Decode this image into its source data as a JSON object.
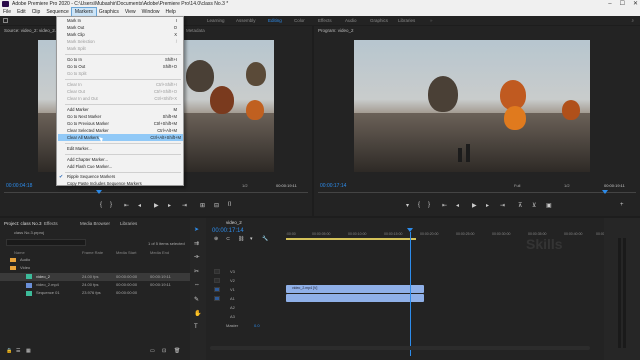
{
  "titlebar": {
    "title": "Adobe Premiere Pro 2020 - C:\\Users\\Mubashir\\Documents\\Adobe\\Premiere Pro\\14.0\\class No.3 *"
  },
  "menubar": {
    "items": [
      "File",
      "Edit",
      "Clip",
      "Sequence",
      "Markers",
      "Graphics",
      "View",
      "Window",
      "Help"
    ],
    "active": "Markers"
  },
  "workspaces": {
    "items": [
      "Learning",
      "Assembly",
      "Editing",
      "Color",
      "Effects",
      "Audio",
      "Graphics",
      "Libraries"
    ],
    "active": "Editing"
  },
  "source_monitor": {
    "tab": "Source: video_2: video_2.mp4: 00:00:00:00",
    "extra_tab": "Metadata",
    "timecode": "00:00:04:18",
    "fraction": "1/2",
    "duration": "00:00:19:11"
  },
  "program_monitor": {
    "tab": "Program: video_2",
    "timecode": "00:00:17:14",
    "fit": "Full",
    "fraction": "1/2",
    "duration": "00:00:19:11"
  },
  "markers_menu": {
    "items": [
      {
        "label": "Mark In",
        "shortcut": "I",
        "disabled": false
      },
      {
        "label": "Mark Out",
        "shortcut": "O",
        "disabled": false
      },
      {
        "label": "Mark Clip",
        "shortcut": "X",
        "disabled": false
      },
      {
        "label": "Mark Selection",
        "shortcut": "/",
        "disabled": true
      },
      {
        "label": "Mark Split",
        "shortcut": "",
        "disabled": true
      },
      {
        "label": "Go to In",
        "shortcut": "Shift+I",
        "disabled": false
      },
      {
        "label": "Go to Out",
        "shortcut": "Shift+O",
        "disabled": false
      },
      {
        "label": "Go to Split",
        "shortcut": "",
        "disabled": true
      },
      {
        "label": "Clear In",
        "shortcut": "Ctrl+Shift+I",
        "disabled": true
      },
      {
        "label": "Clear Out",
        "shortcut": "Ctrl+Shift+O",
        "disabled": true
      },
      {
        "label": "Clear In and Out",
        "shortcut": "Ctrl+Shift+X",
        "disabled": true
      },
      {
        "label": "Add Marker",
        "shortcut": "M",
        "disabled": false
      },
      {
        "label": "Go to Next Marker",
        "shortcut": "Shift+M",
        "disabled": false
      },
      {
        "label": "Go to Previous Marker",
        "shortcut": "Ctrl+Shift+M",
        "disabled": false
      },
      {
        "label": "Clear Selected Marker",
        "shortcut": "Ctrl+Alt+M",
        "disabled": false
      },
      {
        "label": "Clear All Markers",
        "shortcut": "Ctrl+Alt+Shift+M",
        "disabled": false
      },
      {
        "label": "Edit Marker...",
        "shortcut": "",
        "disabled": false
      },
      {
        "label": "Add Chapter Marker...",
        "shortcut": "",
        "disabled": false
      },
      {
        "label": "Add Flash Cue Marker...",
        "shortcut": "",
        "disabled": false
      },
      {
        "label": "Ripple Sequence Markers",
        "shortcut": "",
        "disabled": false
      },
      {
        "label": "Copy Paste Includes Sequence Markers",
        "shortcut": "",
        "disabled": false
      }
    ],
    "highlighted": "Clear All Markers",
    "checked": "Ripple Sequence Markers"
  },
  "project_panel": {
    "tabs": [
      "Project: class No.3",
      "Effects",
      "Media Browser",
      "Libraries"
    ],
    "project_name": "class No.3.prproj",
    "items_selected": "1 of 5 items selected",
    "columns": [
      "Name",
      "Frame Rate",
      "Media Start",
      "Media End"
    ],
    "rows": [
      {
        "name": "Audio",
        "fps": "",
        "start": "",
        "end": ""
      },
      {
        "name": "Video",
        "fps": "",
        "start": "",
        "end": ""
      },
      {
        "name": "video_2",
        "fps": "24.00 fps",
        "start": "00:00:00:00",
        "end": "00:00:19:11"
      },
      {
        "name": "video_2.mp4",
        "fps": "24.00 fps",
        "start": "00:00:00:00",
        "end": "00:00:19:11"
      },
      {
        "name": "Sequence 01",
        "fps": "23.976 fps",
        "start": "00:00:00:00",
        "end": ""
      }
    ]
  },
  "timeline": {
    "tab": "video_2",
    "timecode": "00:00:17:14",
    "ticks": [
      ":00:00",
      "00:00:05:00",
      "00:00:10:00",
      "00:00:15:00",
      "00:00:20:00",
      "00:00:25:00",
      "00:00:30:00",
      "00:00:35:00",
      "00:00:40:00",
      "00:00:45:00"
    ],
    "tracks": [
      "V3",
      "V2",
      "V1",
      "A1",
      "A2",
      "A3"
    ],
    "master_label": "Master",
    "master_value": "0.0",
    "clip_label": "video_2.mp4 [V]"
  },
  "watermark": "Skills"
}
